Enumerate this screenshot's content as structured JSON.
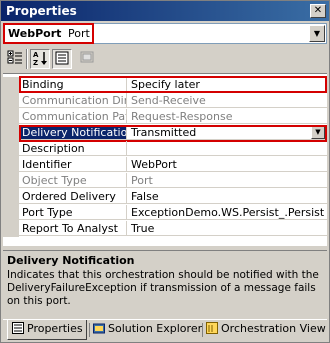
{
  "window": {
    "title": "Properties"
  },
  "object_selector": {
    "name": "WebPort",
    "type": "Port"
  },
  "properties": [
    {
      "name": "Binding",
      "value": "Specify later",
      "state": "normal"
    },
    {
      "name": "Communication Direct",
      "value": "Send-Receive",
      "state": "readonly"
    },
    {
      "name": "Communication Patter",
      "value": "Request-Response",
      "state": "readonly"
    },
    {
      "name": "Delivery Notification",
      "value": "Transmitted",
      "state": "selected"
    },
    {
      "name": "Description",
      "value": "",
      "state": "normal"
    },
    {
      "name": "Identifier",
      "value": "WebPort",
      "state": "normal"
    },
    {
      "name": "Object Type",
      "value": "Port",
      "state": "readonly"
    },
    {
      "name": "Ordered Delivery",
      "value": "False",
      "state": "normal"
    },
    {
      "name": "Port Type",
      "value": "ExceptionDemo.WS.Persist_.Persist",
      "state": "normal"
    },
    {
      "name": "Report To Analyst",
      "value": "True",
      "state": "normal"
    }
  ],
  "description": {
    "title": "Delivery Notification",
    "text": "Indicates that this orchestration should be notified with the DeliveryFailureException if transmission of a message fails on this port."
  },
  "tabs": [
    {
      "label": "Properties",
      "icon": "properties-icon",
      "active": true
    },
    {
      "label": "Solution Explorer",
      "icon": "solution-explorer-icon",
      "active": false
    },
    {
      "label": "Orchestration View",
      "icon": "orchestration-view-icon",
      "active": false
    }
  ],
  "colors": {
    "highlight": "#d40000",
    "selection": "#0a246a",
    "readonly_text": "#808080"
  }
}
